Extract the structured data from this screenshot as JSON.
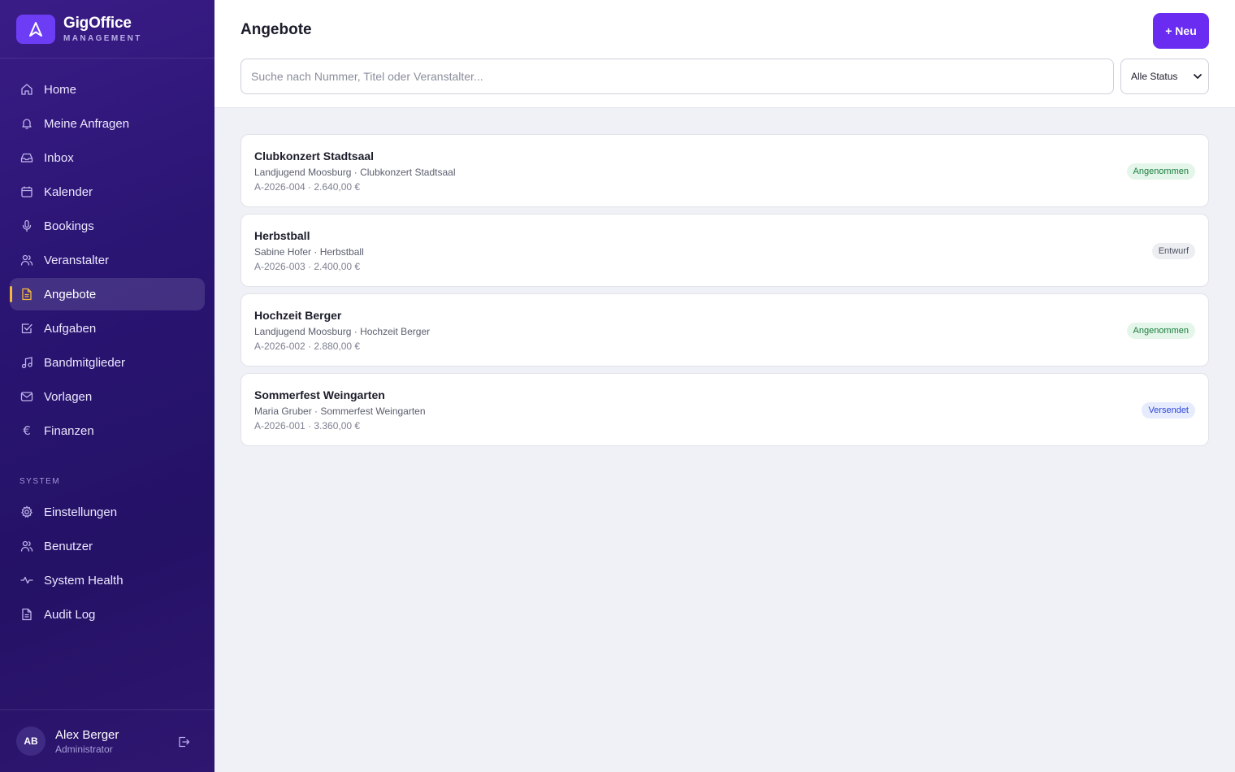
{
  "brand": {
    "name": "GigOffice",
    "subtitle": "MANAGEMENT"
  },
  "nav": [
    {
      "label": "Home",
      "icon": "home-icon"
    },
    {
      "label": "Meine Anfragen",
      "icon": "bell-icon"
    },
    {
      "label": "Inbox",
      "icon": "inbox-icon"
    },
    {
      "label": "Kalender",
      "icon": "calendar-icon"
    },
    {
      "label": "Bookings",
      "icon": "microphone-icon"
    },
    {
      "label": "Veranstalter",
      "icon": "users-icon"
    },
    {
      "label": "Angebote",
      "icon": "document-icon",
      "active": true
    },
    {
      "label": "Aufgaben",
      "icon": "checkbox-icon"
    },
    {
      "label": "Bandmitglieder",
      "icon": "music-note-icon"
    },
    {
      "label": "Vorlagen",
      "icon": "mail-icon"
    },
    {
      "label": "Finanzen",
      "icon": "euro-icon"
    }
  ],
  "system": {
    "title": "SYSTEM",
    "items": [
      {
        "label": "Einstellungen",
        "icon": "gear-icon"
      },
      {
        "label": "Benutzer",
        "icon": "users-icon"
      },
      {
        "label": "System Health",
        "icon": "pulse-icon"
      },
      {
        "label": "Audit Log",
        "icon": "document-icon"
      }
    ]
  },
  "user": {
    "initials": "AB",
    "name": "Alex Berger",
    "role": "Administrator"
  },
  "header": {
    "title": "Angebote",
    "new_button": "+ Neu"
  },
  "search": {
    "placeholder": "Suche nach Nummer, Titel oder Veranstalter...",
    "value": ""
  },
  "status_filter": {
    "selected": "Alle Status"
  },
  "offers": [
    {
      "title": "Clubkonzert Stadtsaal",
      "subtitle": "Landjugend Moosburg · Clubkonzert Stadtsaal",
      "meta": "A-2026-004 · 2.640,00 €",
      "status": "Angenommen",
      "status_color": "#1a7d3e"
    },
    {
      "title": "Herbstball",
      "subtitle": "Sabine Hofer · Herbstball",
      "meta": "A-2026-003 · 2.400,00 €",
      "status": "Entwurf",
      "status_color": "#4d5160"
    },
    {
      "title": "Hochzeit Berger",
      "subtitle": "Landjugend Moosburg · Hochzeit Berger",
      "meta": "A-2026-002 · 2.880,00 €",
      "status": "Angenommen",
      "status_color": "#1a7d3e"
    },
    {
      "title": "Sommerfest Weingarten",
      "subtitle": "Maria Gruber · Sommerfest Weingarten",
      "meta": "A-2026-001 · 3.360,00 €",
      "status": "Versendet",
      "status_color": "#2f48d8"
    }
  ],
  "colors": {
    "accent": "#6a2cf0",
    "sidebar": "#2a1573",
    "active_marker": "#f5b83d"
  }
}
